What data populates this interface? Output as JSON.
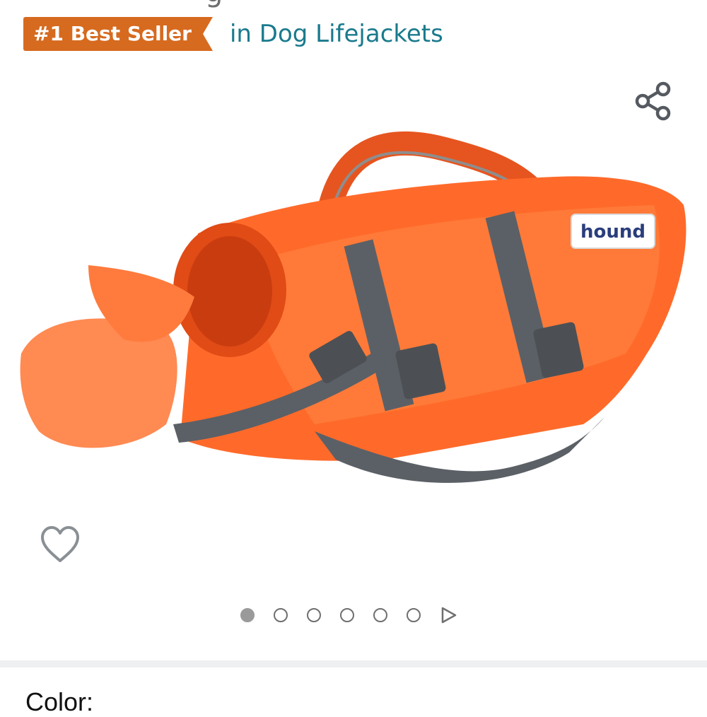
{
  "header": {
    "cut_text": "g",
    "badge_label": "#1 Best Seller",
    "category_link": "in Dog Lifejackets"
  },
  "product_image": {
    "brand_logo_text": "hound"
  },
  "icons": {
    "share": "share-icon",
    "wishlist": "heart-icon",
    "next": "play-icon"
  },
  "carousel": {
    "total_dots": 6,
    "active_index": 0
  },
  "options": {
    "color_label": "Color:"
  },
  "colors": {
    "badge": "#d66a1f",
    "link": "#1a7a8d",
    "vest_orange": "#ff6a2a",
    "strap_gray": "#5b6066"
  }
}
